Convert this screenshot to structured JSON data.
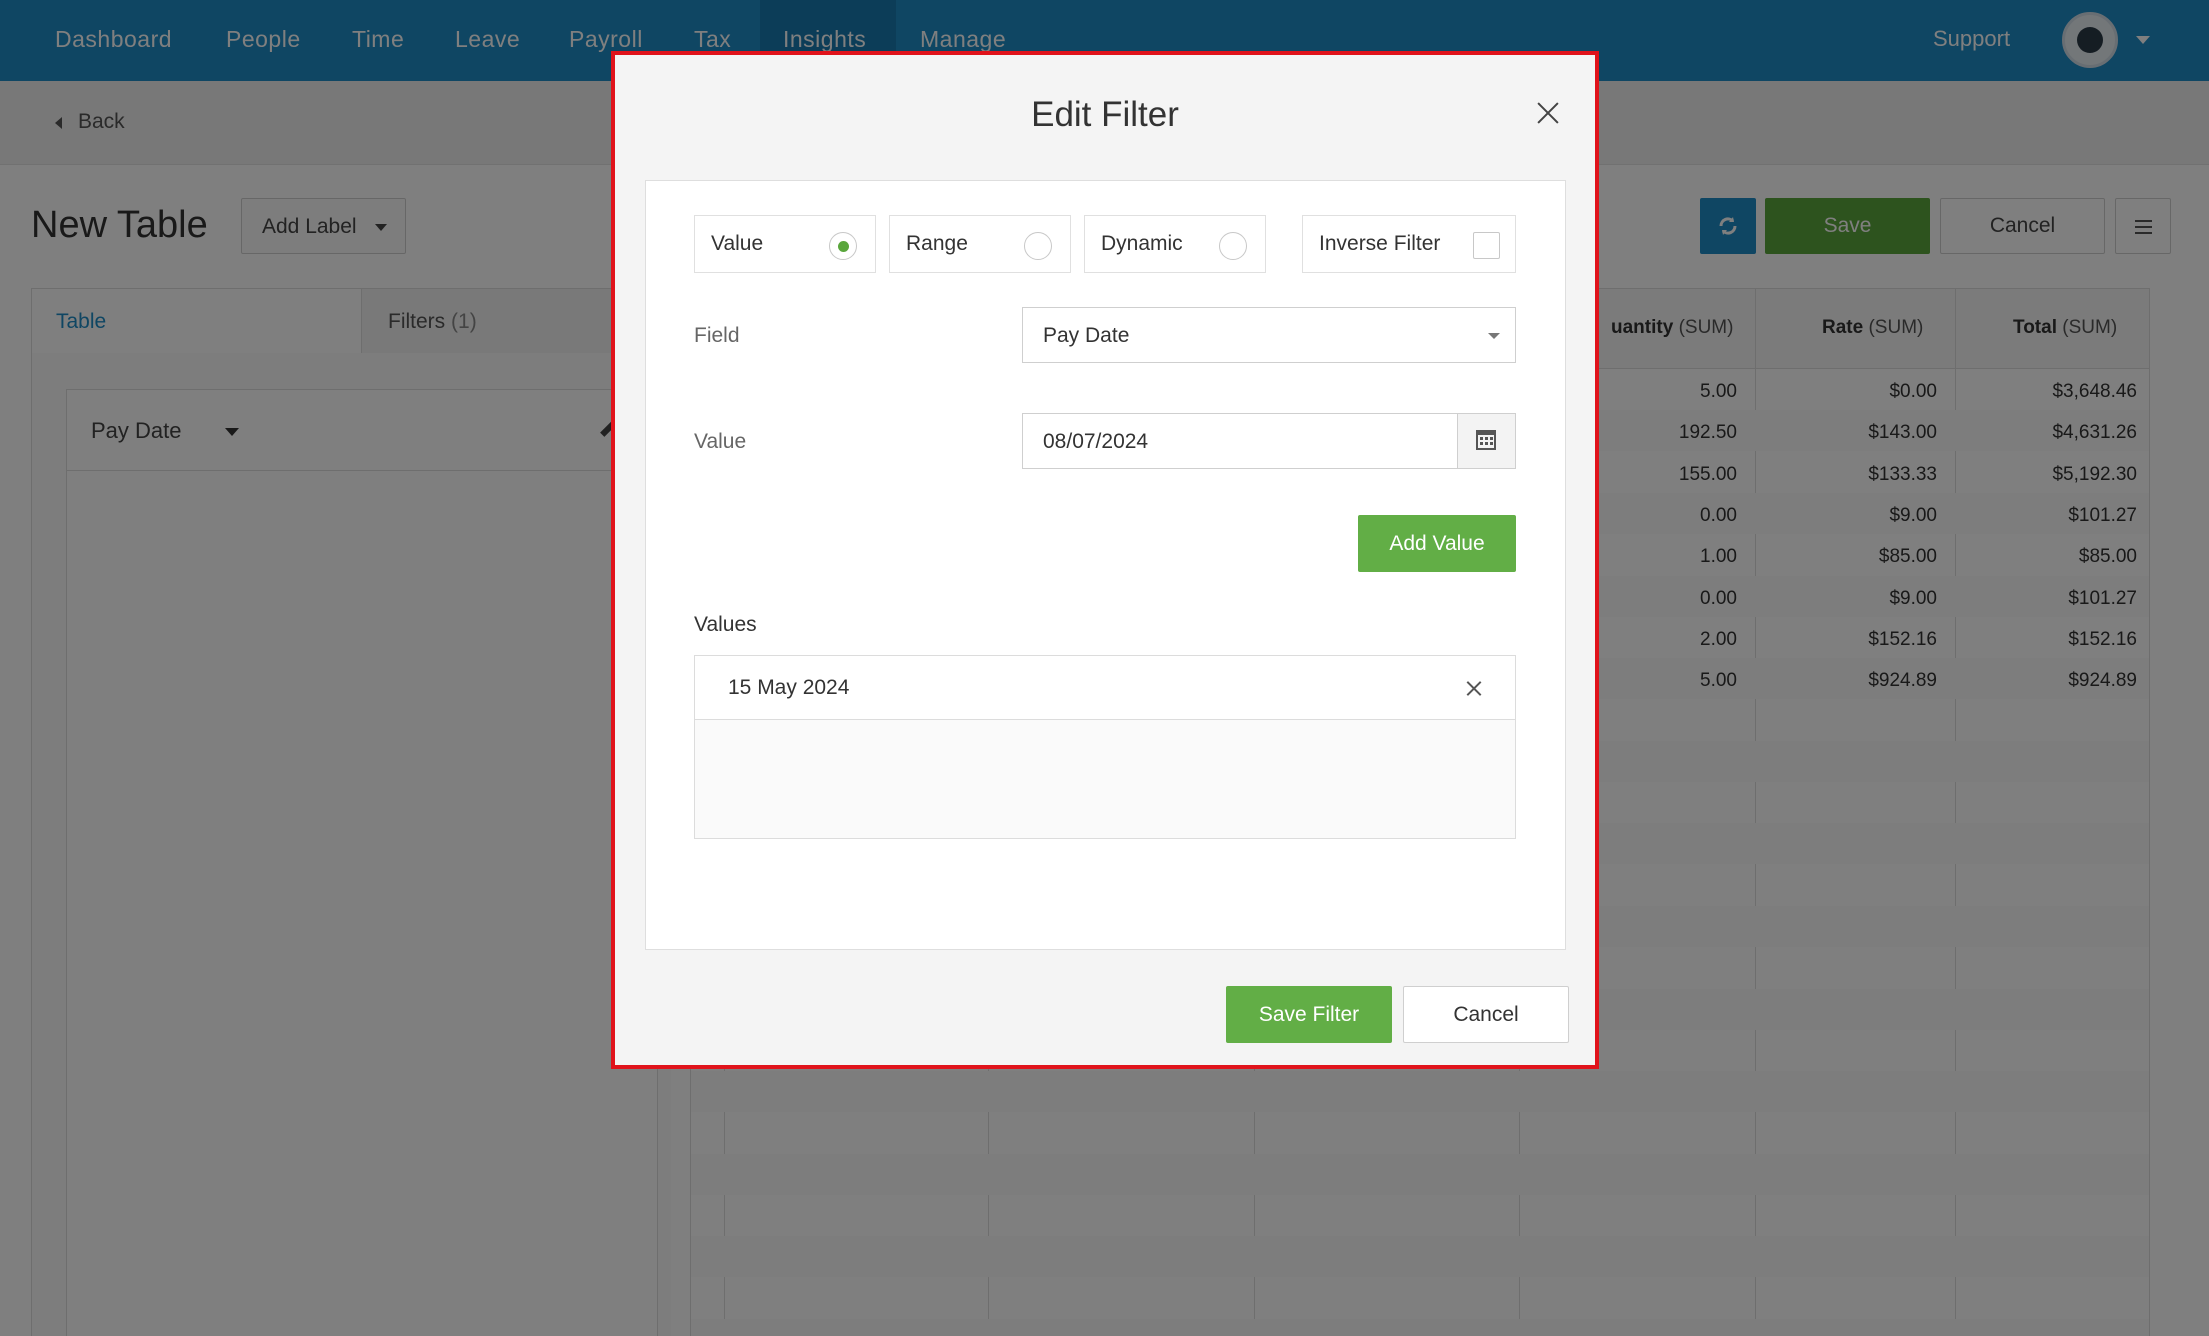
{
  "nav": {
    "items": [
      "Dashboard",
      "People",
      "Time",
      "Leave",
      "Payroll",
      "Tax",
      "Insights",
      "Manage"
    ],
    "active": "Insights",
    "support": "Support"
  },
  "subbar": {
    "back": "Back"
  },
  "header": {
    "title": "New Table",
    "add_label": "Add Label",
    "save": "Save",
    "cancel": "Cancel"
  },
  "left_panel": {
    "tabs": [
      {
        "label": "Table"
      },
      {
        "label": "Filters",
        "count": "(1)"
      }
    ],
    "field": "Pay Date"
  },
  "table": {
    "columns": [
      {
        "name": "uantity",
        "agg": "(SUM)"
      },
      {
        "name": "Rate",
        "agg": "(SUM)"
      },
      {
        "name": "Total",
        "agg": "(SUM)"
      }
    ],
    "rows": [
      [
        "5.00",
        "$0.00",
        "$3,648.46"
      ],
      [
        "192.50",
        "$143.00",
        "$4,631.26"
      ],
      [
        "155.00",
        "$133.33",
        "$5,192.30"
      ],
      [
        "0.00",
        "$9.00",
        "$101.27"
      ],
      [
        "1.00",
        "$85.00",
        "$85.00"
      ],
      [
        "0.00",
        "$9.00",
        "$101.27"
      ],
      [
        "2.00",
        "$152.16",
        "$152.16"
      ],
      [
        "5.00",
        "$924.89",
        "$924.89"
      ]
    ]
  },
  "modal": {
    "title": "Edit Filter",
    "options": [
      {
        "label": "Value",
        "selected": true
      },
      {
        "label": "Range",
        "selected": false
      },
      {
        "label": "Dynamic",
        "selected": false
      }
    ],
    "inverse_filter": {
      "label": "Inverse Filter",
      "checked": false
    },
    "field_label": "Field",
    "field_value": "Pay Date",
    "value_label": "Value",
    "value_input": "08/07/2024",
    "add_value": "Add Value",
    "values_label": "Values",
    "values": [
      "15 May 2024"
    ],
    "save_filter": "Save Filter",
    "cancel": "Cancel"
  },
  "colors": {
    "nav_bg": "#1f8dc6",
    "primary_green": "#62ae46",
    "highlight_border": "#e0131b"
  }
}
